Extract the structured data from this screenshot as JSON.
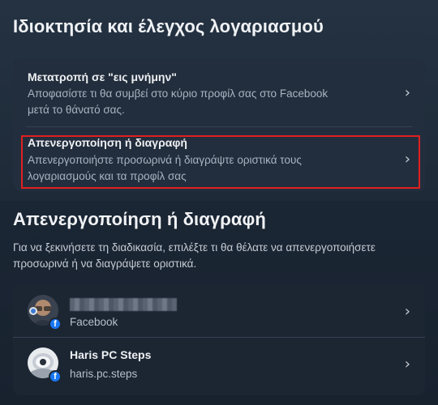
{
  "ownership": {
    "title": "Ιδιοκτησία και έλεγχος λογαριασμού",
    "items": [
      {
        "title": "Μετατροπή σε \"εις μνήμην\"",
        "description_line1": "Αποφασίστε τι θα συμβεί στο κύριο προφίλ σας στο Facebook",
        "description_line2": "μετά το θάνατό σας."
      },
      {
        "title": "Απενεργοποίηση ή διαγραφή",
        "description_line1": "Απενεργοποιήστε προσωρινά ή διαγράψτε οριστικά τους",
        "description_line2": "λογαριασμούς και τα προφίλ σας"
      }
    ]
  },
  "deactivate": {
    "title": "Απενεργοποίηση ή διαγραφή",
    "intro_line1": "Για να ξεκινήσετε τη διαδικασία, επιλέξτε τι θα θέλατε να απενεργοποιήσετε",
    "intro_line2": "προσωρινά ή να διαγράψετε οριστικά.",
    "accounts": [
      {
        "name": "",
        "platform": "Facebook"
      },
      {
        "name": "Haris PC Steps",
        "platform": "haris.pc.steps"
      }
    ]
  },
  "icons": {
    "chevron": "chevron-right-icon",
    "badge": "facebook-icon"
  },
  "colors": {
    "highlight": "#e02020",
    "facebook_blue": "#1877f2"
  }
}
